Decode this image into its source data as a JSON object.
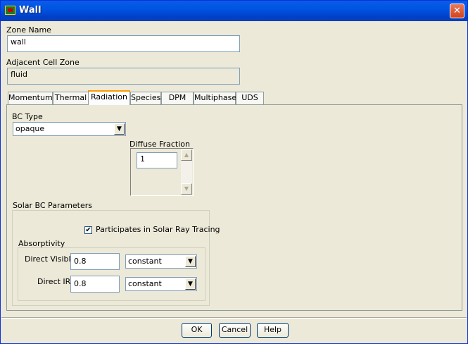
{
  "window": {
    "title": "Wall",
    "close_glyph": "✕"
  },
  "zone_name": {
    "label": "Zone Name",
    "value": "wall"
  },
  "adjacent_cell_zone": {
    "label": "Adjacent Cell Zone",
    "value": "fluid"
  },
  "tabs": [
    {
      "label": "Momentum",
      "active": false
    },
    {
      "label": "Thermal",
      "active": false
    },
    {
      "label": "Radiation",
      "active": true
    },
    {
      "label": "Species",
      "active": false
    },
    {
      "label": "DPM",
      "active": false
    },
    {
      "label": "Multiphase",
      "active": false
    },
    {
      "label": "UDS",
      "active": false
    }
  ],
  "radiation": {
    "bc_type_label": "BC Type",
    "bc_type_value": "opaque",
    "diffuse_fraction_label": "Diffuse Fraction",
    "diffuse_fraction_value": "1",
    "solar_group_label": "Solar BC Parameters",
    "participates_label": "Participates in Solar Ray Tracing",
    "participates_checked": true,
    "check_glyph": "✔",
    "absorptivity_label": "Absorptivity",
    "direct_visible_label": "Direct Visible",
    "direct_visible_value": "0.8",
    "direct_visible_method": "constant",
    "direct_ir_label": "Direct IR",
    "direct_ir_value": "0.8",
    "direct_ir_method": "constant"
  },
  "buttons": {
    "ok": "OK",
    "cancel": "Cancel",
    "help": "Help"
  },
  "icons": {
    "dropdown": "▼",
    "scroll_up": "▲",
    "scroll_down": "▼"
  }
}
